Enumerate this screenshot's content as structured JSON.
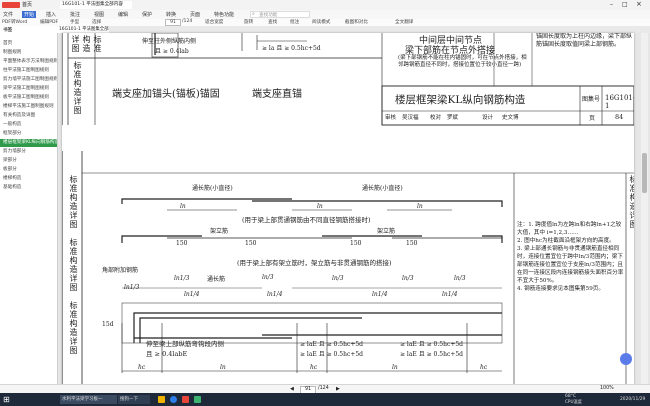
{
  "window": {
    "app_tab": "首页",
    "doc_tab": "16G101-1 平法图集全部内容",
    "icons": [
      "minimize-icon",
      "maximize-icon",
      "close-icon"
    ]
  },
  "menu": {
    "items": [
      "文件",
      "开始",
      "插入",
      "批注",
      "视图",
      "编辑",
      "保护",
      "转换",
      "页面",
      "特色功能"
    ],
    "search_placeholder": "查找功能"
  },
  "toolbar": {
    "items": [
      "PDF转Word",
      "编辑PDF",
      "手型",
      "选择",
      "91",
      "/124",
      "适合宽度",
      "旋转",
      "查找",
      "批注",
      "阅读模式",
      "截图和对比",
      "全文翻译"
    ]
  },
  "sidebar": {
    "title": "书签",
    "items": [
      {
        "label": "首页",
        "active": false
      },
      {
        "label": "制图规则",
        "active": false
      },
      {
        "label": "平面整体表示方法制图规则",
        "active": false
      },
      {
        "label": "柱平法施工图制图规则",
        "active": false
      },
      {
        "label": "剪力墙平法施工图制图规则",
        "active": false
      },
      {
        "label": "梁平法施工图制图规则",
        "active": false
      },
      {
        "label": "板平法施工图制图规则",
        "active": false
      },
      {
        "label": "楼梯平法施工图制图规则",
        "active": false
      },
      {
        "label": "有关构造及详图",
        "active": false
      },
      {
        "label": "一般构造",
        "active": false
      },
      {
        "label": "框架部分",
        "active": false
      },
      {
        "label": "楼层框架梁KL纵向钢筋构造",
        "active": true
      },
      {
        "label": "剪力墙部分",
        "active": false
      },
      {
        "label": "梁部分",
        "active": false
      },
      {
        "label": "板部分",
        "active": false
      },
      {
        "label": "楼梯构造",
        "active": false
      },
      {
        "label": "基础构造",
        "active": false
      }
    ]
  },
  "drawing": {
    "top_left": {
      "side_label": "标准构造详图",
      "text1": "伸至柱外侧纵筋内侧",
      "text2": "且 ≥ 0.4lab",
      "text3": "≥ 0.4labE",
      "text4": "≥ la 且 ≥ 0.5hc+5d"
    },
    "left_caption": "端支座加锚头(锚板)锚固",
    "right_caption": "端支座直锚",
    "mid_title_1": "中间层中间节点",
    "mid_title_2": "梁下部筋在节点外搭接",
    "mid_note": "(梁下部钢筋不能在柱内锚固时，可在节点外搭接，相邻跨钢筋直径不同时，搭接位置位于较小直径一跨)",
    "right_note": "锚固长度取为上柱内边缘，梁下部纵筋锚固长度取值同梁上部钢筋。",
    "title_block": {
      "title": "楼层框架梁KL纵向钢筋构造",
      "atlas_label": "图集号",
      "atlas_no": "16G101-1",
      "row2": [
        "审核",
        "吴汉福",
        "校对",
        "罗斌",
        "设计",
        "史文博"
      ],
      "page_label": "页",
      "page_no": "84"
    },
    "side_labels": [
      "标准构造详图",
      "标准构造详图",
      "标准构造详图",
      "标准构造详图"
    ],
    "lower": {
      "tongchang_1": "通长筋(小直径)",
      "tongchang_2": "通长筋(小直径)",
      "ln1": "ln",
      "note_1": "(用于梁上部贯通钢筋由不同直径钢筋搭接时)",
      "jialijin_1": "架立筋",
      "jialijin_2": "架立筋",
      "dim_150": "150",
      "note_2": "(用于梁上部有架立筋时，架立筋与非贯通钢筋的搭接)",
      "jiaobu": "角部附加钢筋",
      "tongchang_3": "通长筋",
      "ln3": "ln1/3",
      "ln4": "ln1/4",
      "ln5": "ln/3",
      "dim_15d": "15d",
      "support": "伸至梁上部纵筋弯钩段内侧",
      "support2": "且 ≥ 0.4labE",
      "lae": "≥ laE 且 ≥ 0.5hc+5d",
      "hc": "hc",
      "ln_bottom": "ln"
    },
    "notes": [
      "注：1. 跨度值ln为左跨ln和右跨ln+1之较大值，其中 i=1,2,3……",
      "2. 图中hc为柱截面沿框架方向的高度。",
      "3. 梁上部通长钢筋与非贯通钢筋直径相同时，连接位置宜位于跨中ln/3范围内；梁下部钢筋连接位置宜位于支座ln/3范围内；且在同一连接区段内连接钢筋接头面积百分率不宜大于50%。",
      "4. 钢筋连接要求见本图集第59页。"
    ]
  },
  "statusbar": {
    "page": "91",
    "total": "/124",
    "zoom": "100%"
  },
  "taskbar": {
    "items": [
      "水利平法梁学习板一",
      "搜狗一下"
    ],
    "time": "68°C",
    "cpu": "CPU温度",
    "date": "2020/11/29"
  }
}
